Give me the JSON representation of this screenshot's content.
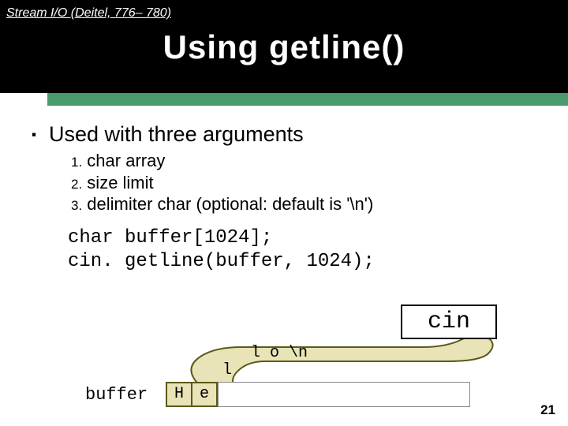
{
  "header": {
    "stream_label": "Stream I/O (Deitel, 776– 780)",
    "title": "Using getline()"
  },
  "bullet": "Used with three arguments",
  "numbered": {
    "items": [
      {
        "num": "1.",
        "text": " char array"
      },
      {
        "num": "2.",
        "text": " size limit"
      },
      {
        "num": "3.",
        "text": " delimiter char (optional: default is '\\n')"
      }
    ]
  },
  "code": {
    "line1": "char buffer[1024];",
    "line2": "cin. getline(buffer, 1024);"
  },
  "diagram": {
    "cin_label": "cin",
    "blob_text": "l o \\n",
    "blob_l": "l",
    "buffer_label": "buffer",
    "cells": [
      "H",
      "e"
    ]
  },
  "page_number": "21"
}
